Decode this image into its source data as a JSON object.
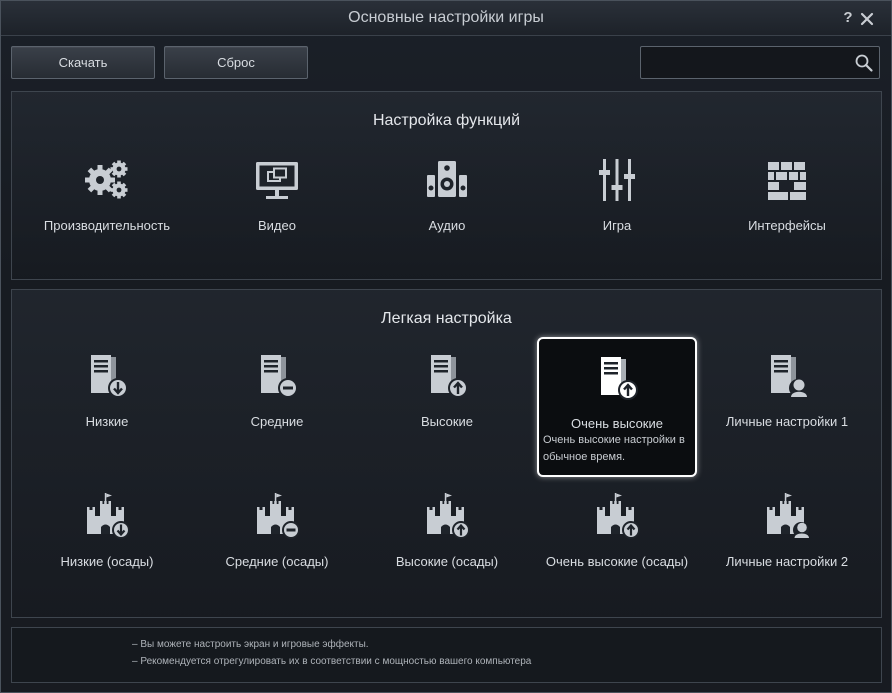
{
  "window": {
    "title": "Основные настройки игры",
    "help": "?"
  },
  "toolbar": {
    "download_label": "Скачать",
    "reset_label": "Сброс",
    "search_placeholder": "",
    "search_value": ""
  },
  "features": {
    "title": "Настройка функций",
    "items": [
      {
        "label": "Производительность",
        "icon": "gears-icon"
      },
      {
        "label": "Видео",
        "icon": "monitor-icon"
      },
      {
        "label": "Аудио",
        "icon": "speaker-icon"
      },
      {
        "label": "Игра",
        "icon": "sliders-icon"
      },
      {
        "label": "Интерфейсы",
        "icon": "blocks-icon"
      }
    ]
  },
  "easy": {
    "title": "Легкая настройка",
    "presets": [
      {
        "label": "Низкие",
        "icon": "server-down-icon"
      },
      {
        "label": "Средние",
        "icon": "server-minus-icon"
      },
      {
        "label": "Высокие",
        "icon": "server-up-icon"
      },
      {
        "label": "Очень высокие",
        "icon": "server-up-icon",
        "description": "Очень высокие настройки в обычное время.",
        "selected": true
      },
      {
        "label": "Личные настройки 1",
        "icon": "server-user-icon"
      }
    ],
    "siege_presets": [
      {
        "label": "Низкие (осады)",
        "icon": "castle-down-icon"
      },
      {
        "label": "Средние (осады)",
        "icon": "castle-minus-icon"
      },
      {
        "label": "Высокие (осады)",
        "icon": "castle-up-icon"
      },
      {
        "label": "Очень высокие (осады)",
        "icon": "castle-up-icon"
      },
      {
        "label": "Личные настройки 2",
        "icon": "castle-user-icon"
      }
    ]
  },
  "footer": {
    "lines": [
      "– Вы можете настроить экран и игровые эффекты.",
      "– Рекомендуется отрегулировать их в соответствии с мощностью вашего компьютера"
    ]
  },
  "colors": {
    "icon": "#c8cdd3",
    "selected_border": "#ffffff",
    "background": "#171b21"
  }
}
